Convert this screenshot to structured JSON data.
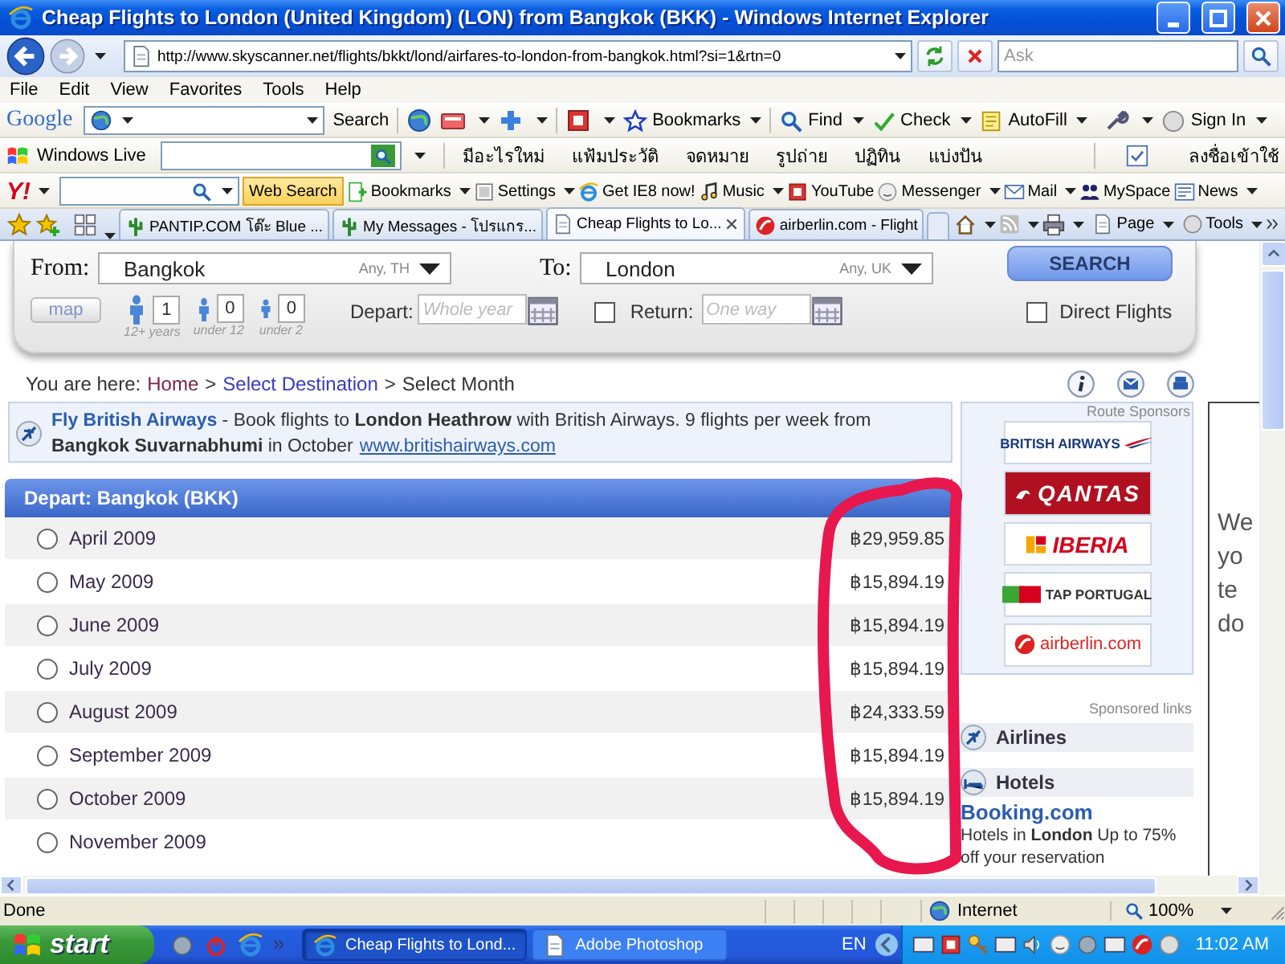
{
  "window": {
    "title": "Cheap Flights to London (United Kingdom) (LON) from Bangkok (BKK) - Windows Internet Explorer"
  },
  "address_bar": {
    "url": "http://www.skyscanner.net/flights/bkkt/lond/airfares-to-london-from-bangkok.html?si=1&rtn=0",
    "search_placeholder": "Ask"
  },
  "menu": [
    "File",
    "Edit",
    "View",
    "Favorites",
    "Tools",
    "Help"
  ],
  "google_toolbar": {
    "logo": "Google",
    "items": [
      {
        "label": "Search",
        "kind": "button"
      },
      {
        "label": "Bookmarks",
        "kind": "menu"
      },
      {
        "label": "Find",
        "kind": "menu"
      },
      {
        "label": "Check",
        "kind": "menu"
      },
      {
        "label": "AutoFill",
        "kind": "menu"
      },
      {
        "label": "Sign In",
        "kind": "menu"
      }
    ]
  },
  "live_toolbar": {
    "brand": "Windows Live",
    "links": [
      "มีอะไรใหม่",
      "แฟ้มประวัติ",
      "จดหมาย",
      "รูปถ่าย",
      "ปฏิทิน",
      "แบ่งปัน"
    ],
    "sign_in": "ลงชื่อเข้าใช้"
  },
  "yahoo_toolbar": {
    "logo": "Y!",
    "search_button": "Web Search",
    "items": [
      {
        "label": "Bookmarks",
        "kind": "menu"
      },
      {
        "label": "Settings",
        "kind": "menu"
      },
      {
        "label": "Get IE8 now!",
        "kind": "button"
      },
      {
        "label": "Music",
        "kind": "menu"
      },
      {
        "label": "YouTube",
        "kind": "button"
      },
      {
        "label": "Messenger",
        "kind": "menu"
      },
      {
        "label": "Mail",
        "kind": "menu"
      },
      {
        "label": "MySpace",
        "kind": "button"
      },
      {
        "label": "News",
        "kind": "menu"
      }
    ]
  },
  "tabs": [
    {
      "label": "PANTIP.COM โต๊ะ Blue ...",
      "selected": false
    },
    {
      "label": "My Messages - โปรแกร...",
      "selected": false
    },
    {
      "label": "Cheap Flights to Lo...",
      "selected": true
    },
    {
      "label": "airberlin.com - Flight",
      "selected": false
    }
  ],
  "command_bar": [
    "Page",
    "Tools"
  ],
  "search_form": {
    "from_label": "From:",
    "from": "Bangkok",
    "from_hint": "Any, TH",
    "to_label": "To:",
    "to": "London",
    "to_hint": "Any, UK",
    "search_button": "SEARCH",
    "map_button": "map",
    "passengers": [
      {
        "count": "1",
        "label": "12+ years"
      },
      {
        "count": "0",
        "label": "under 12"
      },
      {
        "count": "0",
        "label": "under 2"
      }
    ],
    "depart_label": "Depart:",
    "depart_placeholder": "Whole year",
    "return_checked": false,
    "return_label": "Return:",
    "return_placeholder": "One way",
    "direct_checked": false,
    "direct_label": "Direct Flights"
  },
  "breadcrumb": {
    "prefix": "You are here:",
    "separator": ">",
    "items": [
      {
        "label": "Home",
        "kind": "visited"
      },
      {
        "label": "Select Destination",
        "kind": "link"
      },
      {
        "label": "Select Month",
        "kind": "current"
      }
    ]
  },
  "ad": {
    "title": "Fly British Airways",
    "text": " - Book flights to **London Heathrow** with British Airways. 9 flights per week from **Bangkok Suvarnabhumi** in October",
    "link": "www.britishairways.com"
  },
  "departures": {
    "title": "Depart: Bangkok (BKK)",
    "months": [
      {
        "label": "April 2009",
        "price": "฿29,959.85",
        "selected": false
      },
      {
        "label": "May 2009",
        "price": "฿15,894.19",
        "selected": false
      },
      {
        "label": "June 2009",
        "price": "฿15,894.19",
        "selected": false
      },
      {
        "label": "July 2009",
        "price": "฿15,894.19",
        "selected": false
      },
      {
        "label": "August 2009",
        "price": "฿24,333.59",
        "selected": false
      },
      {
        "label": "September 2009",
        "price": "฿15,894.19",
        "selected": false
      },
      {
        "label": "October 2009",
        "price": "฿15,894.19",
        "selected": false
      },
      {
        "label": "November 2009",
        "selected": false
      }
    ]
  },
  "sponsors": {
    "title": "Route Sponsors",
    "logos": [
      {
        "text": "BRITISH AIRWAYS",
        "kind": "british-airways"
      },
      {
        "text": "QANTAS",
        "kind": "qantas"
      },
      {
        "text": "IBERIA",
        "kind": "iberia"
      },
      {
        "text": "TAP PORTUGAL",
        "kind": "tap"
      },
      {
        "text": "airberlin.com",
        "kind": "airberlin"
      }
    ]
  },
  "sponsored_links": {
    "title": "Sponsored links",
    "sections": [
      {
        "title": "Airlines",
        "kind": "airlines"
      },
      {
        "title": "Hotels",
        "kind": "hotels",
        "ads": [
          {
            "title": "Booking.com",
            "text": "Hotels in **London** Up to 75% off your reservation"
          }
        ]
      }
    ]
  },
  "side_frame": {
    "lines": [
      "We",
      "yo",
      "te",
      "do"
    ]
  },
  "annotation": {
    "kind": "circle"
  },
  "status_bar": {
    "text": "Done",
    "zone": "Internet",
    "zoom": "100%"
  },
  "taskbar": {
    "start": "start",
    "tasks": [
      {
        "label": "Cheap Flights to Lond...",
        "selected": true
      },
      {
        "label": "Adobe Photoshop",
        "selected": false
      }
    ],
    "language": "EN",
    "clock": "11:02 AM"
  }
}
